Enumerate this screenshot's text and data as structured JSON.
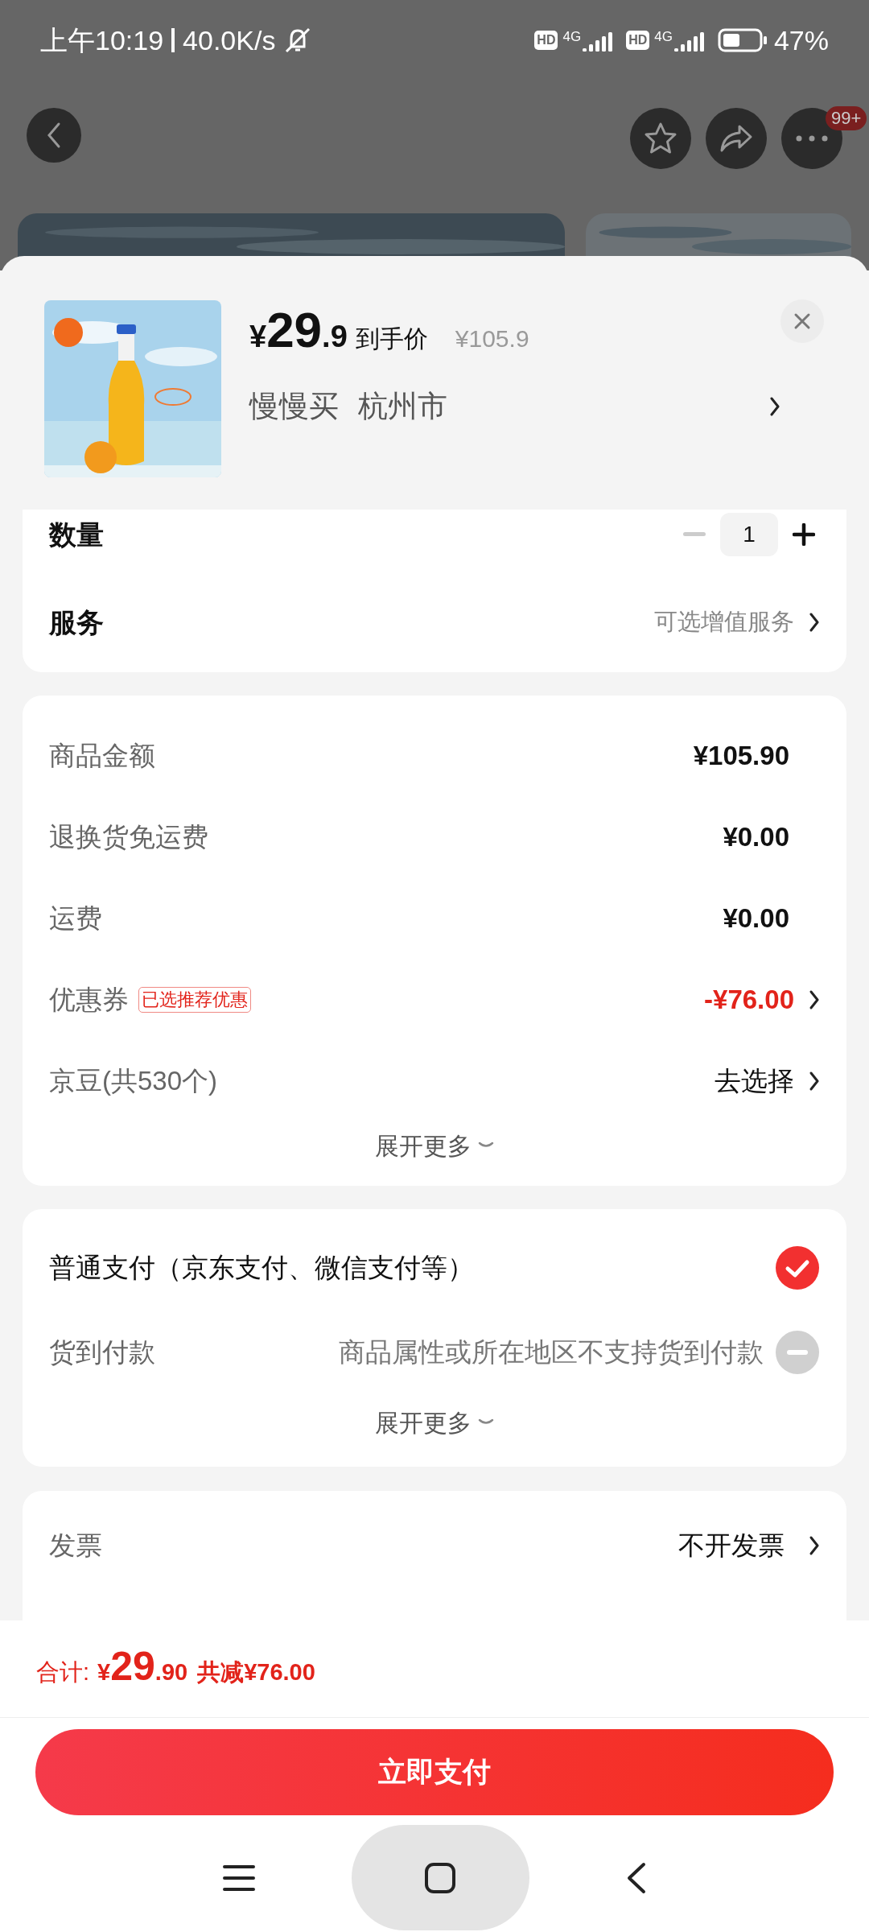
{
  "status_bar": {
    "time": "上午10:19",
    "speed": "40.0K/s",
    "sims": [
      {
        "hd": "HD",
        "net": "4G"
      },
      {
        "hd": "HD",
        "net": "4G"
      }
    ],
    "battery": "47%"
  },
  "header": {
    "badge": "99+"
  },
  "product": {
    "price_symbol": "¥",
    "price_int": "29",
    "price_dec": ".9",
    "price_label": "到手价",
    "original_price": "¥105.9",
    "store": "慢慢买",
    "city": "杭州市"
  },
  "quantity": {
    "label": "数量",
    "value": "1",
    "minus_disabled": true
  },
  "service": {
    "label": "服务",
    "value": "可选增值服务"
  },
  "amounts": [
    {
      "kind": "amount",
      "label": "商品金额",
      "value": "¥105.90"
    },
    {
      "kind": "amount",
      "label": "退换货免运费",
      "value": "¥0.00"
    },
    {
      "kind": "amount",
      "label": "运费",
      "value": "¥0.00"
    },
    {
      "kind": "discount",
      "label": "优惠券",
      "tag": "已选推荐优惠",
      "value": "-¥76.00"
    },
    {
      "kind": "select",
      "label": "京豆(共530个)",
      "value": "去选择"
    }
  ],
  "amounts_more": "展开更多",
  "payments": [
    {
      "label": "普通支付（京东支付、微信支付等）",
      "selected": true,
      "disabled": false
    },
    {
      "label": "货到付款",
      "note": "商品属性或所在地区不支持货到付款",
      "selected": false,
      "disabled": true
    }
  ],
  "payments_more": "展开更多",
  "invoice": {
    "label": "发票",
    "value": "不开发票"
  },
  "footer": {
    "total_label": "合计:",
    "total_symbol": "¥",
    "total_int": "29",
    "total_dec": ".90",
    "saving": "共减¥76.00",
    "pay_button": "立即支付"
  }
}
